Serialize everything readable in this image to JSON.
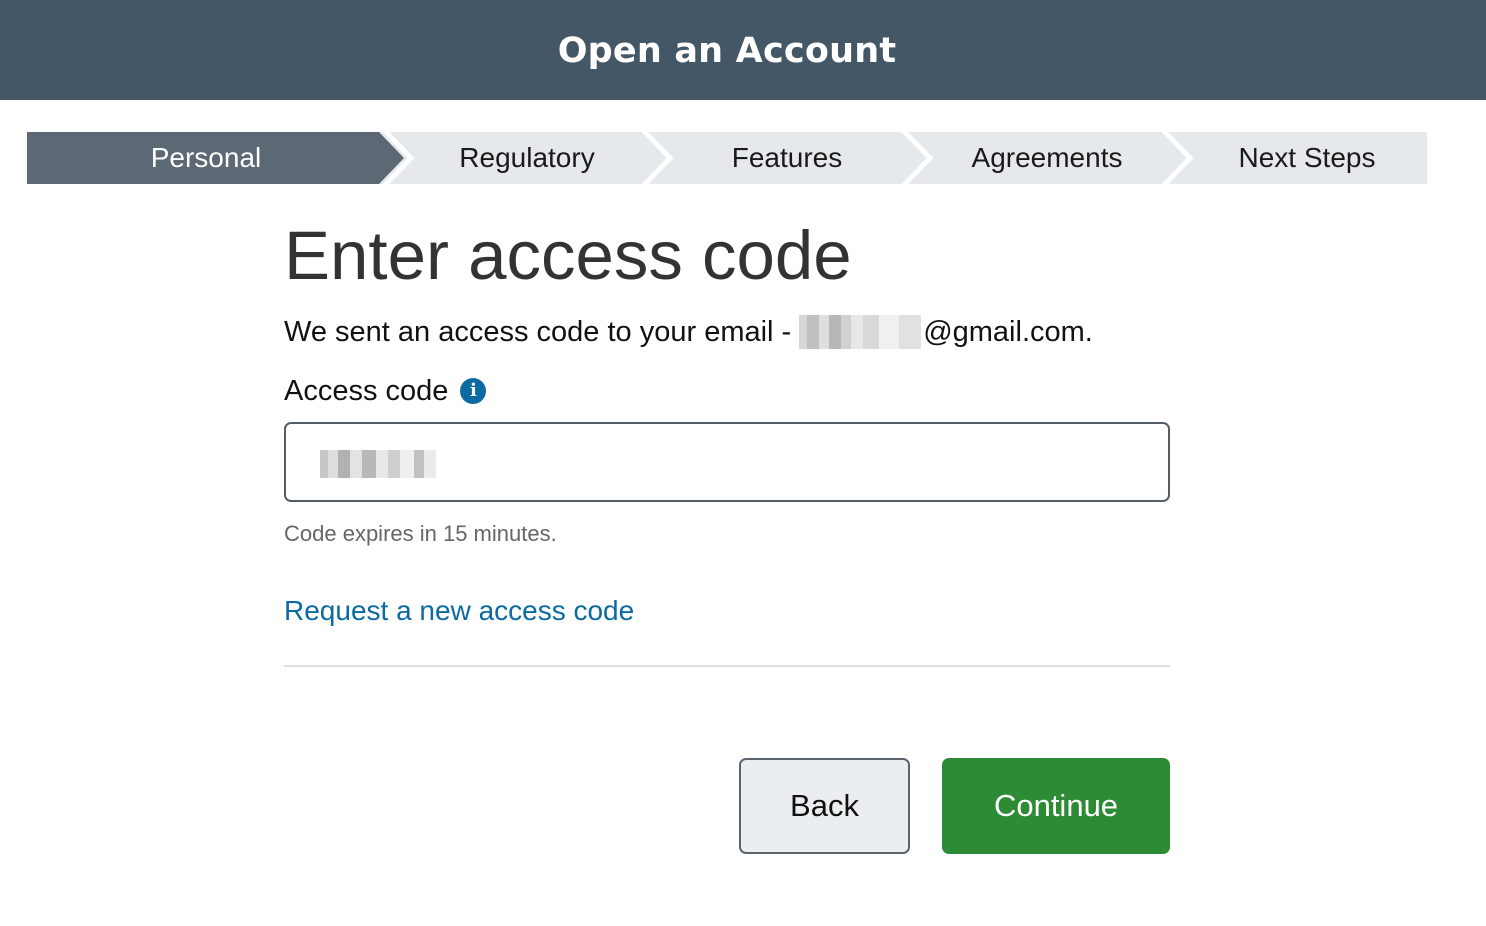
{
  "header": {
    "title": "Open an Account"
  },
  "stepper": {
    "steps": [
      {
        "label": "Personal",
        "active": true
      },
      {
        "label": "Regulatory",
        "active": false
      },
      {
        "label": "Features",
        "active": false
      },
      {
        "label": "Agreements",
        "active": false
      },
      {
        "label": "Next Steps",
        "active": false
      }
    ]
  },
  "main": {
    "title": "Enter access code",
    "sent_prefix": "We sent an access code to your email -",
    "email_domain": "@gmail.com.",
    "field_label": "Access code",
    "info_icon": "info-icon",
    "code_value": "",
    "hint": "Code expires in 15 minutes.",
    "request_link": "Request a new access code"
  },
  "buttons": {
    "back": "Back",
    "continue": "Continue"
  },
  "colors": {
    "header_bg": "#445766",
    "stepper_active": "#5c6873",
    "stepper_inactive": "#e6e9ec",
    "link": "#0a6aa1",
    "continue_bg": "#2e8b35",
    "back_bg": "#ebeef0"
  }
}
